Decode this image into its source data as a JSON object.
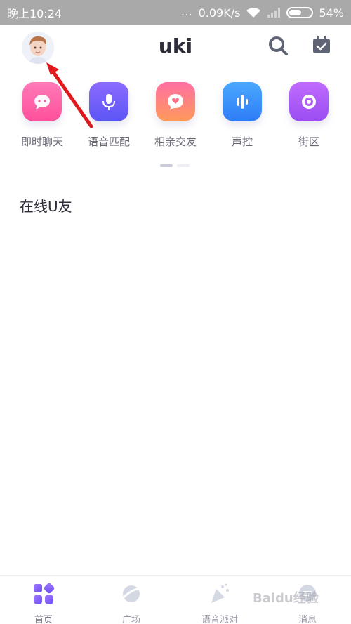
{
  "status_bar": {
    "time": "晚上10:24",
    "dots": "...",
    "network_speed": "0.09K/s",
    "battery_percent": "54%",
    "battery_level": 0.54
  },
  "header": {
    "logo_text": "uki",
    "avatar_icon": "avatar-icon",
    "search_icon": "search-icon",
    "calendar_icon": "calendar-check-icon"
  },
  "features": [
    {
      "label": "即时聊天",
      "icon": "chat-bubble-icon",
      "color_top": "#ff7ab8",
      "color_bottom": "#ff4f9b"
    },
    {
      "label": "语音匹配",
      "icon": "microphone-icon",
      "color_top": "#8c6bff",
      "color_bottom": "#5b55f5"
    },
    {
      "label": "相亲交友",
      "icon": "heart-bubble-icon",
      "color_top": "#ff6fa3",
      "color_bottom": "#ff9a5a"
    },
    {
      "label": "声控",
      "icon": "sound-wave-icon",
      "color_top": "#4aa8ff",
      "color_bottom": "#2f7cf6"
    },
    {
      "label": "街区",
      "icon": "ring-icon",
      "color_top": "#c06bff",
      "color_bottom": "#9a4df0"
    }
  ],
  "pager": {
    "active": 0,
    "count": 2
  },
  "section": {
    "title": "在线U友"
  },
  "tabs": [
    {
      "label": "首页",
      "icon": "home-grid-icon",
      "active": true
    },
    {
      "label": "广场",
      "icon": "planet-icon",
      "active": false
    },
    {
      "label": "语音派对",
      "icon": "party-popper-icon",
      "active": false
    },
    {
      "label": "消息",
      "icon": "message-icon",
      "active": false
    }
  ],
  "watermark": "Baidu经验",
  "colors": {
    "accent": "#7b5cff",
    "status_bar_bg": "#a9a9a9",
    "arrow": "#e0191c"
  }
}
